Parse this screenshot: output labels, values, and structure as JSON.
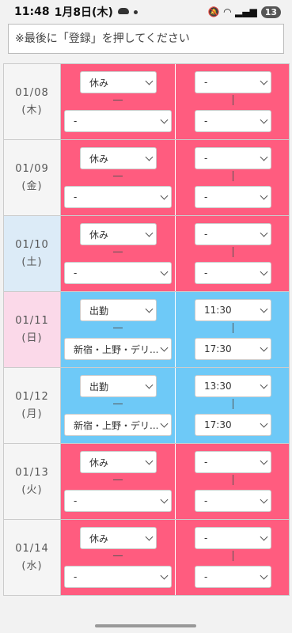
{
  "statusbar": {
    "time": "11:48",
    "date": "1月8日(木)",
    "badge": "13"
  },
  "notice": "※最後に「登録」を押してください",
  "rows": [
    {
      "date": "01/08",
      "day": "(木)",
      "status": "休み",
      "location": "-",
      "start": "-",
      "end": "-"
    },
    {
      "date": "01/09",
      "day": "(金)",
      "status": "休み",
      "location": "-",
      "start": "-",
      "end": "-"
    },
    {
      "date": "01/10",
      "day": "(土)",
      "status": "休み",
      "location": "-",
      "start": "-",
      "end": "-"
    },
    {
      "date": "01/11",
      "day": "(日)",
      "status": "出勤",
      "location": "新宿・上野・デリ...",
      "start": "11:30",
      "end": "17:30"
    },
    {
      "date": "01/12",
      "day": "(月)",
      "status": "出勤",
      "location": "新宿・上野・デリ...",
      "start": "13:30",
      "end": "17:30"
    },
    {
      "date": "01/13",
      "day": "(火)",
      "status": "休み",
      "location": "-",
      "start": "-",
      "end": "-"
    },
    {
      "date": "01/14",
      "day": "(水)",
      "status": "休み",
      "location": "-",
      "start": "-",
      "end": "-"
    }
  ],
  "colors": {
    "off": "#ff5c7f",
    "on": "#6ec9f7",
    "saturday": "#dcebf7",
    "sunday": "#fbd9e9"
  }
}
